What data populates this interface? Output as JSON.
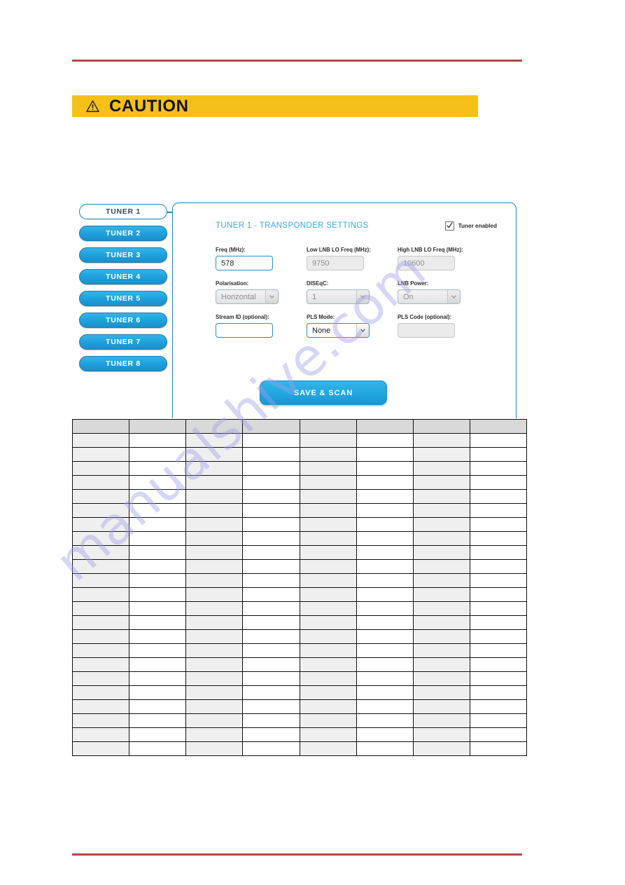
{
  "page": {
    "rule_color": "#b04a40"
  },
  "caution": {
    "icon": "warning-triangle-icon",
    "label": "CAUTION",
    "background": "#f5c119"
  },
  "watermark": {
    "text": "manualshive.com",
    "color": "#9f9fe8"
  },
  "figure": {
    "tabs": [
      {
        "label": "TUNER 1",
        "selected": true
      },
      {
        "label": "TUNER 2",
        "selected": false
      },
      {
        "label": "TUNER 3",
        "selected": false
      },
      {
        "label": "TUNER 4",
        "selected": false
      },
      {
        "label": "TUNER 5",
        "selected": false
      },
      {
        "label": "TUNER 6",
        "selected": false
      },
      {
        "label": "TUNER 7",
        "selected": false
      },
      {
        "label": "TUNER 8",
        "selected": false
      }
    ],
    "panel": {
      "title": "TUNER 1 - TRANSPONDER SETTINGS",
      "title_color": "#3aa8dd",
      "border_color": "#1f86bb",
      "enable": {
        "label": "Tuner enabled",
        "checked": true
      },
      "fields": {
        "freq": {
          "label": "Freq (MHz):",
          "value": "578"
        },
        "low_lnb": {
          "label": "Low LNB LO Freq (MHz):",
          "value": "9750"
        },
        "high_lnb": {
          "label": "High LNB LO Freq (MHz):",
          "value": "10600"
        },
        "polarisation": {
          "label": "Polarisation:",
          "value": "Horizontal"
        },
        "diseqc": {
          "label": "DISEqC:",
          "value": "1"
        },
        "lnb_power": {
          "label": "LNB Power:",
          "value": "On"
        },
        "stream_id": {
          "label": "Stream ID (optional):",
          "value": ""
        },
        "pls_mode": {
          "label": "PLS Mode:",
          "value": "None"
        },
        "pls_code": {
          "label": "PLS Code (optional):",
          "value": ""
        }
      },
      "save_button": {
        "label": "SAVE & SCAN",
        "color": "#22a6e0"
      }
    }
  },
  "table": {
    "columns": 8,
    "rows": 23,
    "header": [
      "",
      "",
      "",
      "",
      "",
      "",
      "",
      ""
    ],
    "cells": []
  }
}
